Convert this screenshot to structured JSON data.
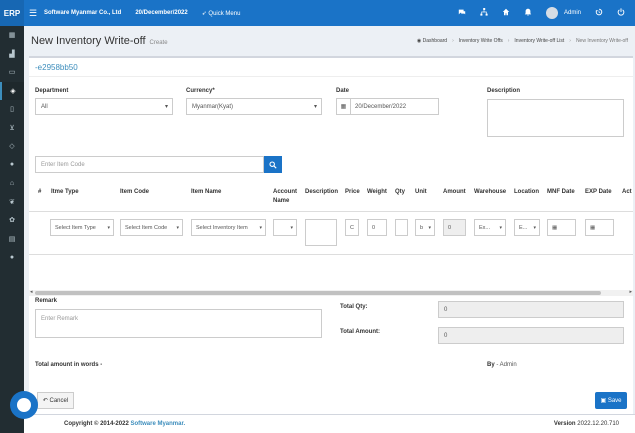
{
  "topbar": {
    "logo": "ERP",
    "menu_icon": "☰",
    "company": "Software Myanmar Co., Ltd",
    "date": "20/December/2022",
    "quick_menu": "Quick Menu",
    "quick_menu_icon": "➶",
    "icons": [
      "chat-icon",
      "network-icon",
      "home-icon",
      "bell-icon"
    ],
    "username": "Admin"
  },
  "sidebar": {
    "items": [
      "calculator-icon",
      "chart-icon",
      "card-icon",
      "box-icon",
      "clipboard-icon",
      "cart-icon",
      "diamond-icon",
      "users-icon",
      "bank-icon",
      "leaf-icon",
      "settings-icon",
      "book-icon",
      "chat-icon"
    ]
  },
  "header": {
    "title": "New Inventory Write-off",
    "subtitle": "Create",
    "breadcrumb": [
      "Dashboard",
      "Inventory Write Offs",
      "Inventory Write-off List",
      "New Inventory Write-off"
    ]
  },
  "form": {
    "doc_id": "-e2958bb50",
    "department_label": "Department",
    "department_value": "All",
    "currency_label": "Currency*",
    "currency_value": "Myanmar(Kyat)",
    "date_label": "Date",
    "date_value": "20/December/2022",
    "description_label": "Description",
    "item_code_placeholder": "Enter Item Code"
  },
  "table": {
    "headers": [
      "#",
      "Itme Type",
      "Item Code",
      "Item Name",
      "Account Name",
      "Description",
      "Price",
      "Weight",
      "Qty",
      "Unit",
      "Amount",
      "Warehouse",
      "Location",
      "MNF Date",
      "EXP Date",
      "Act"
    ],
    "row": {
      "item_type": "Select Item Type",
      "item_code": "Select Item Code",
      "item_name": "Select Inventory Item",
      "price": "C",
      "weight": "0",
      "unit": "b",
      "amount": "0",
      "warehouse": "Ex...",
      "location": "E..."
    }
  },
  "summary": {
    "remark_label": "Remark",
    "remark_placeholder": "Enter Remark",
    "total_qty_label": "Total Qty:",
    "total_qty_value": "0",
    "total_amount_label": "Total Amount:",
    "total_amount_value": "0",
    "words_label": "Total amount in words -",
    "by_label": "By",
    "by_value": "- Admin"
  },
  "buttons": {
    "cancel": "Cancel",
    "save": "Save"
  },
  "footer": {
    "copyright": "Copyright © 2014-2022",
    "brand": "Software Myanmar.",
    "version_label": "Version",
    "version_value": "2022.12.20.710"
  },
  "colors": {
    "primary": "#1a73c7",
    "sidebar": "#222d32",
    "link": "#3c8dbc"
  }
}
